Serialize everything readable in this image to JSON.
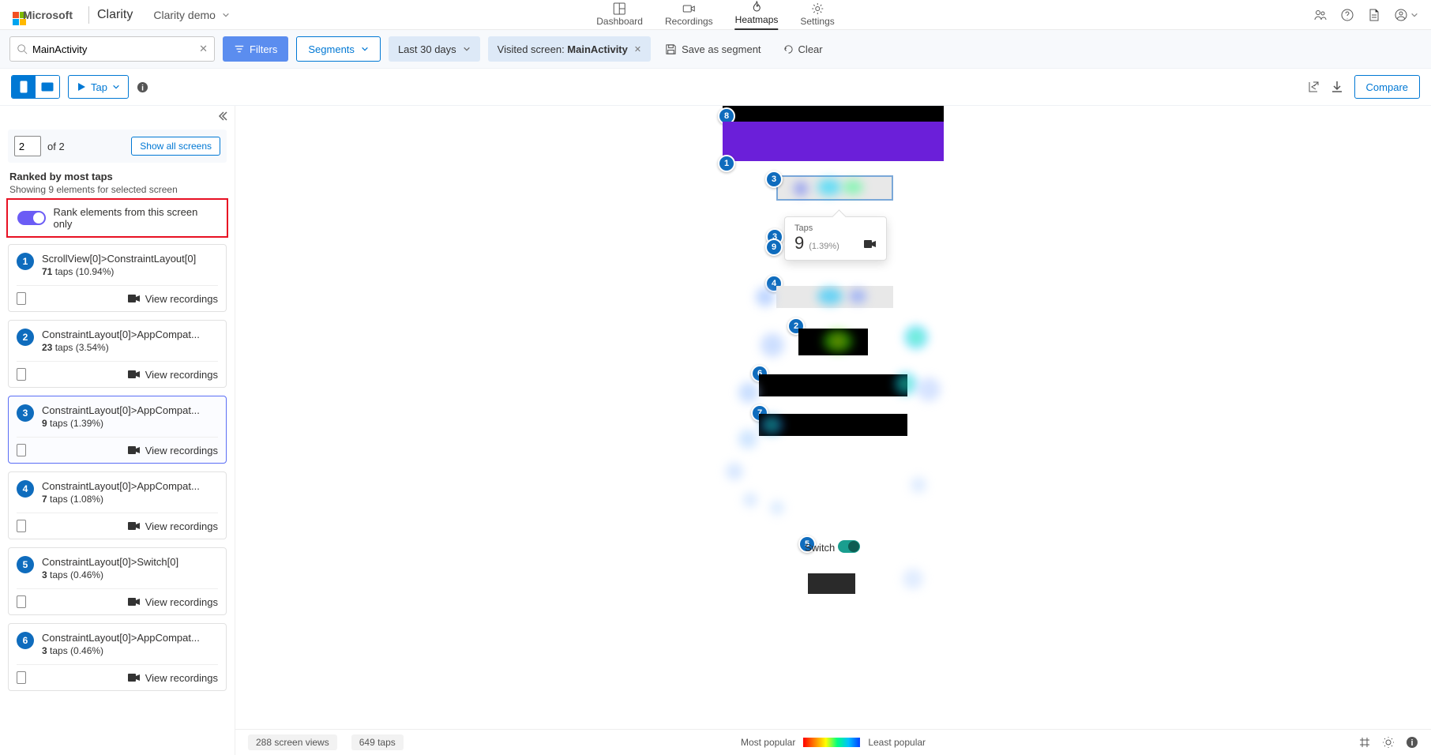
{
  "header": {
    "microsoft": "Microsoft",
    "product": "Clarity",
    "project": "Clarity demo",
    "nav": {
      "dashboard": "Dashboard",
      "recordings": "Recordings",
      "heatmaps": "Heatmaps",
      "settings": "Settings"
    }
  },
  "filters": {
    "search_value": "MainActivity",
    "filters_btn": "Filters",
    "segments_btn": "Segments",
    "date_chip": "Last 30 days",
    "screen_chip_label": "Visited screen: ",
    "screen_chip_value": "MainActivity",
    "save_segment": "Save as segment",
    "clear": "Clear"
  },
  "toolbar": {
    "tap_label": "Tap",
    "compare": "Compare"
  },
  "sidebar": {
    "screen_input": "2",
    "screen_total": "of 2",
    "show_all": "Show all screens",
    "rank_title": "Ranked by most taps",
    "rank_sub": "Showing 9 elements for selected screen",
    "toggle_label": "Rank elements from this screen only",
    "view_recordings": "View recordings",
    "items": [
      {
        "n": "1",
        "name": "ScrollView[0]>ConstraintLayout[0]",
        "count": "71",
        "unit": "taps",
        "pct": "(10.94%)"
      },
      {
        "n": "2",
        "name": "ConstraintLayout[0]>AppCompat...",
        "count": "23",
        "unit": "taps",
        "pct": "(3.54%)"
      },
      {
        "n": "3",
        "name": "ConstraintLayout[0]>AppCompat...",
        "count": "9",
        "unit": "taps",
        "pct": "(1.39%)"
      },
      {
        "n": "4",
        "name": "ConstraintLayout[0]>AppCompat...",
        "count": "7",
        "unit": "taps",
        "pct": "(1.08%)"
      },
      {
        "n": "5",
        "name": "ConstraintLayout[0]>Switch[0]",
        "count": "3",
        "unit": "taps",
        "pct": "(0.46%)"
      },
      {
        "n": "6",
        "name": "ConstraintLayout[0]>AppCompat...",
        "count": "3",
        "unit": "taps",
        "pct": "(0.46%)"
      }
    ]
  },
  "tooltip": {
    "label": "Taps",
    "value": "9",
    "pct": "(1.39%)"
  },
  "canvas": {
    "switch_label": "Switch"
  },
  "status": {
    "screen_views": "288 screen views",
    "taps": "649 taps",
    "most": "Most popular",
    "least": "Least popular"
  }
}
